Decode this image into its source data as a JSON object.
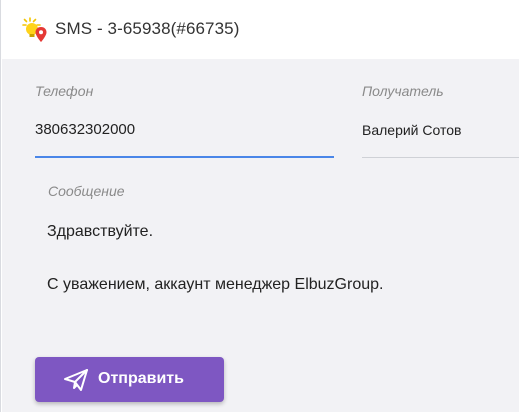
{
  "window": {
    "title": "SMS - 3-65938(#66735)",
    "icon": "bulb-pin-icon"
  },
  "form": {
    "phone": {
      "label": "Телефон",
      "value": "380632302000"
    },
    "recipient": {
      "label": "Получатель",
      "value": "Валерий Сотов"
    },
    "message": {
      "label": "Сообщение",
      "line1": "Здравствуйте.",
      "line2": "С уважением, аккаунт менеджер ElbuzGroup."
    },
    "send_button": {
      "label": "Отправить",
      "icon": "paper-plane-icon"
    }
  },
  "colors": {
    "accent": "#7e57c2",
    "focus_underline": "#4a86e8",
    "panel_bg": "#f2f2f5"
  }
}
